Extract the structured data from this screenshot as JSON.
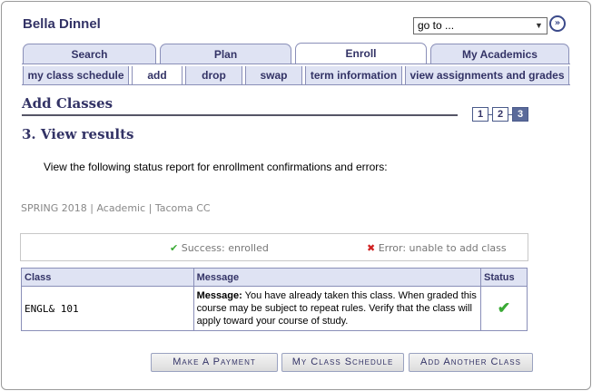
{
  "header": {
    "student_name": "Bella Dinnel",
    "goto": {
      "value": "go to ...",
      "arrow": "▼"
    },
    "go_button": "»"
  },
  "tabs": [
    {
      "label": "Search"
    },
    {
      "label": "Plan"
    },
    {
      "label": "Enroll",
      "active": true
    },
    {
      "label": "My Academics"
    }
  ],
  "subtabs": [
    {
      "label": "my class schedule"
    },
    {
      "label": "add",
      "active": true
    },
    {
      "label": "drop"
    },
    {
      "label": "swap"
    },
    {
      "label": "term information"
    },
    {
      "label": "view assignments and grades"
    }
  ],
  "page_title": "Add Classes",
  "steps": [
    "1",
    "2",
    "3"
  ],
  "step_title": "3.  View results",
  "instruction": "View the following status report for enrollment confirmations and errors:",
  "term_info": "SPRING 2018 | Academic | Tacoma CC",
  "legend": {
    "success_icon": "✔",
    "success": "Success: enrolled",
    "error_icon": "✖",
    "error": "Error: unable to add class"
  },
  "table": {
    "headers": [
      "Class",
      "Message",
      "Status"
    ],
    "rows": [
      {
        "class": "ENGL&  101",
        "message_label": "Message:",
        "message": " You have already taken this class. When graded this course may be subject to repeat rules. Verify that the class will apply toward your course of study.",
        "status_icon": "✔"
      }
    ]
  },
  "buttons": {
    "payment": "Make A Payment",
    "schedule": "My Class Schedule",
    "add_another": "Add Another Class"
  },
  "colors": {
    "brand": "#333366",
    "tab_bg": "#dfe3f3",
    "success": "#3aaa35",
    "error": "#d02020"
  },
  "icons": {
    "go": "go-icon",
    "success": "checkmark-icon",
    "error": "x-icon"
  }
}
